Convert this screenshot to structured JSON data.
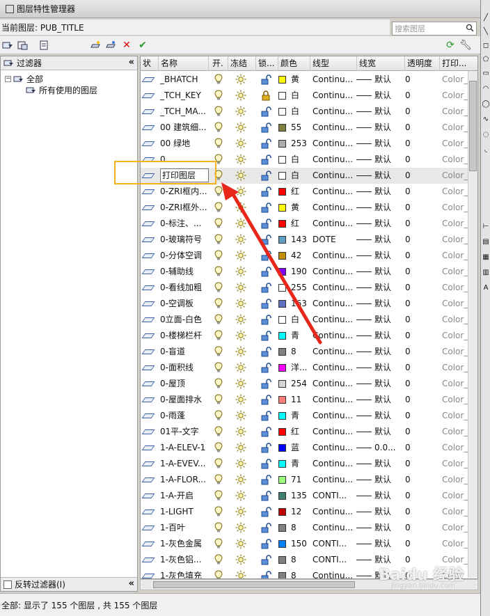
{
  "window": {
    "title": "图层特性管理器"
  },
  "current_layer": {
    "label": "当前图层: PUB_TITLE"
  },
  "search": {
    "placeholder": "搜索图层"
  },
  "filters": {
    "header": "过滤器",
    "tree": [
      {
        "label": "全部"
      },
      {
        "label": "所有使用的图层"
      }
    ],
    "invert_label": "反转过滤器(I)"
  },
  "columns": {
    "status": "状",
    "name": "名称",
    "on": "开.",
    "freeze": "冻结",
    "lock": "锁...",
    "color": "颜色",
    "linetype": "线型",
    "lineweight": "线宽",
    "transparency": "透明度",
    "plot": "打印..."
  },
  "rows": [
    {
      "name": "_BHATCH",
      "color": "黄",
      "hex": "#ffff00",
      "locked": false,
      "linetype": "Continu...",
      "lw": "默认",
      "transp": "0",
      "plot": "Color_"
    },
    {
      "name": "_TCH_KEY",
      "color": "白",
      "hex": "#ffffff",
      "locked": true,
      "linetype": "Continu...",
      "lw": "默认",
      "transp": "0",
      "plot": "Color_"
    },
    {
      "name": "_TCH_MA...",
      "color": "白",
      "hex": "#ffffff",
      "locked": false,
      "linetype": "Continu...",
      "lw": "默认",
      "transp": "0",
      "plot": "Color_"
    },
    {
      "name": "00 建筑细...",
      "color": "55",
      "hex": "#7f7f3f",
      "locked": false,
      "linetype": "Continu...",
      "lw": "默认",
      "transp": "0",
      "plot": "Color_"
    },
    {
      "name": "00 绿地",
      "color": "253",
      "hex": "#adadad",
      "locked": false,
      "linetype": "Continu...",
      "lw": "默认",
      "transp": "0",
      "plot": "Color_"
    },
    {
      "name": "0",
      "color": "白",
      "hex": "#ffffff",
      "locked": false,
      "linetype": "Continu...",
      "lw": "默认",
      "transp": "0",
      "plot": "Color_"
    },
    {
      "name": "打印图层",
      "color": "白",
      "hex": "#ffffff",
      "locked": false,
      "linetype": "Continu...",
      "lw": "默认",
      "transp": "0",
      "plot": "Color_",
      "selected": true
    },
    {
      "name": "0-ZRI框内...",
      "color": "红",
      "hex": "#ff0000",
      "locked": false,
      "linetype": "Continu...",
      "lw": "默认",
      "transp": "0",
      "plot": "Color_"
    },
    {
      "name": "0-ZRI框外...",
      "color": "黄",
      "hex": "#ffff00",
      "locked": false,
      "linetype": "Continu...",
      "lw": "默认",
      "transp": "0",
      "plot": "Color_"
    },
    {
      "name": "0-标注、...",
      "color": "红",
      "hex": "#ff0000",
      "locked": false,
      "linetype": "Continu...",
      "lw": "默认",
      "transp": "0",
      "plot": "Color_"
    },
    {
      "name": "0-玻璃符号",
      "color": "143",
      "hex": "#5f9fbf",
      "locked": false,
      "linetype": "DOTE",
      "lw": "默认",
      "transp": "0",
      "plot": "Color_"
    },
    {
      "name": "0-分体空调",
      "color": "42",
      "hex": "#bf8f00",
      "locked": false,
      "linetype": "Continu...",
      "lw": "默认",
      "transp": "0",
      "plot": "Color_"
    },
    {
      "name": "0-辅助线",
      "color": "190",
      "hex": "#7f00ff",
      "locked": false,
      "linetype": "Continu...",
      "lw": "默认",
      "transp": "0",
      "plot": "Color_"
    },
    {
      "name": "0-看线加粗",
      "color": "255",
      "hex": "#ffffff",
      "locked": false,
      "linetype": "Continu...",
      "lw": "默认",
      "transp": "0",
      "plot": "Color_"
    },
    {
      "name": "0-空调板",
      "color": "163",
      "hex": "#5f6fbf",
      "locked": false,
      "linetype": "Continu...",
      "lw": "默认",
      "transp": "0",
      "plot": "Color_"
    },
    {
      "name": "0立面-白色",
      "color": "白",
      "hex": "#ffffff",
      "locked": false,
      "linetype": "Continu...",
      "lw": "默认",
      "transp": "0",
      "plot": "Color_"
    },
    {
      "name": "0-楼梯栏杆",
      "color": "青",
      "hex": "#00ffff",
      "locked": false,
      "linetype": "Continu...",
      "lw": "默认",
      "transp": "0",
      "plot": "Color_"
    },
    {
      "name": "0-盲道",
      "color": "8",
      "hex": "#808080",
      "locked": false,
      "linetype": "Continu...",
      "lw": "默认",
      "transp": "0",
      "plot": "Color_"
    },
    {
      "name": "0-面积线",
      "color": "洋...",
      "hex": "#ff00ff",
      "locked": false,
      "linetype": "Continu...",
      "lw": "默认",
      "transp": "0",
      "plot": "Color_"
    },
    {
      "name": "0-屋顶",
      "color": "254",
      "hex": "#d6d6d6",
      "locked": false,
      "linetype": "Continu...",
      "lw": "默认",
      "transp": "0",
      "plot": "Color_"
    },
    {
      "name": "0-屋面排水",
      "color": "11",
      "hex": "#ff7f7f",
      "locked": false,
      "linetype": "Continu...",
      "lw": "默认",
      "transp": "0",
      "plot": "Color_"
    },
    {
      "name": "0-雨蓬",
      "color": "青",
      "hex": "#00ffff",
      "locked": false,
      "linetype": "Continu...",
      "lw": "默认",
      "transp": "0",
      "plot": "Color_"
    },
    {
      "name": "01平-文字",
      "color": "红",
      "hex": "#ff0000",
      "locked": false,
      "linetype": "Continu...",
      "lw": "默认",
      "transp": "0",
      "plot": "Color_"
    },
    {
      "name": "1-A-ELEV-1",
      "color": "蓝",
      "hex": "#0000ff",
      "locked": false,
      "linetype": "Continu...",
      "lw": "0.0...",
      "transp": "0",
      "plot": "Color_"
    },
    {
      "name": "1-A-EVEV...",
      "color": "青",
      "hex": "#00ffff",
      "locked": false,
      "linetype": "Continu...",
      "lw": "默认",
      "transp": "0",
      "plot": "Color_"
    },
    {
      "name": "1-A-FLOR...",
      "color": "71",
      "hex": "#9fff7f",
      "locked": false,
      "linetype": "Continu...",
      "lw": "默认",
      "transp": "0",
      "plot": "Color_"
    },
    {
      "name": "1-A-开启",
      "color": "135",
      "hex": "#3f7f6f",
      "locked": false,
      "linetype": "CONTI...",
      "lw": "默认",
      "transp": "0",
      "plot": "Color_"
    },
    {
      "name": "1-LIGHT",
      "color": "12",
      "hex": "#bf0000",
      "locked": false,
      "linetype": "Continu...",
      "lw": "默认",
      "transp": "0",
      "plot": "Color_"
    },
    {
      "name": "1-百叶",
      "color": "8",
      "hex": "#808080",
      "locked": false,
      "linetype": "Continu...",
      "lw": "默认",
      "transp": "0",
      "plot": "Color_"
    },
    {
      "name": "1-灰色金属",
      "color": "150",
      "hex": "#007fff",
      "locked": false,
      "linetype": "CONTI...",
      "lw": "默认",
      "transp": "0",
      "plot": "Color_"
    },
    {
      "name": "1-灰色铝...",
      "color": "8",
      "hex": "#808080",
      "locked": false,
      "linetype": "CONTI...",
      "lw": "默认",
      "transp": "0",
      "plot": "Color_"
    },
    {
      "name": "1-灰色填充",
      "color": "8",
      "hex": "#808080",
      "locked": false,
      "linetype": "Continu...",
      "lw": "默认",
      "transp": "0",
      "plot": "Color_"
    }
  ],
  "status": {
    "text": "全部: 显示了 155 个图层 , 共 155 个图层"
  },
  "watermark": {
    "text": "Baidu 经验",
    "sub": "jingyan.baidu.com"
  },
  "colors": {
    "highlight": "#f2b21b",
    "arrow": "#e8261a",
    "selected_row": "#e8e8e8"
  }
}
